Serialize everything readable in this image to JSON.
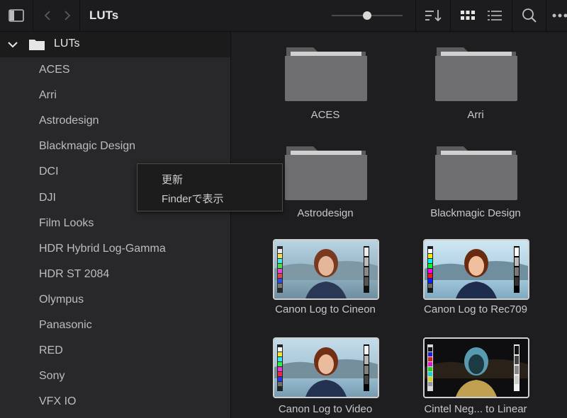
{
  "toolbar": {
    "title": "LUTs",
    "thumb_size_level": 0.5
  },
  "sidebar": {
    "root_label": "LUTs",
    "items": [
      {
        "label": "ACES"
      },
      {
        "label": "Arri"
      },
      {
        "label": "Astrodesign"
      },
      {
        "label": "Blackmagic Design"
      },
      {
        "label": "DCI"
      },
      {
        "label": "DJI"
      },
      {
        "label": "Film Looks"
      },
      {
        "label": "HDR Hybrid Log-Gamma"
      },
      {
        "label": "HDR ST 2084"
      },
      {
        "label": "Olympus"
      },
      {
        "label": "Panasonic"
      },
      {
        "label": "RED"
      },
      {
        "label": "Sony"
      },
      {
        "label": "VFX IO"
      }
    ]
  },
  "context_menu": {
    "items": [
      {
        "label": "更新"
      },
      {
        "label": "Finderで表示"
      }
    ]
  },
  "grid": {
    "tiles": [
      {
        "label": "ACES",
        "kind": "folder"
      },
      {
        "label": "Arri",
        "kind": "folder"
      },
      {
        "label": "Astrodesign",
        "kind": "folder"
      },
      {
        "label": "Blackmagic Design",
        "kind": "folder"
      },
      {
        "label": "Canon Log to Cineon",
        "kind": "lut"
      },
      {
        "label": "Canon Log to Rec709",
        "kind": "lut"
      },
      {
        "label": "Canon Log to Video",
        "kind": "lut"
      },
      {
        "label": "Cintel Neg... to Linear",
        "kind": "lut-negative"
      }
    ]
  },
  "colors": {
    "background": "#1e1e20",
    "sidebar": "#28282a",
    "folder": "#6e6e70",
    "text": "#c8c8c8"
  }
}
